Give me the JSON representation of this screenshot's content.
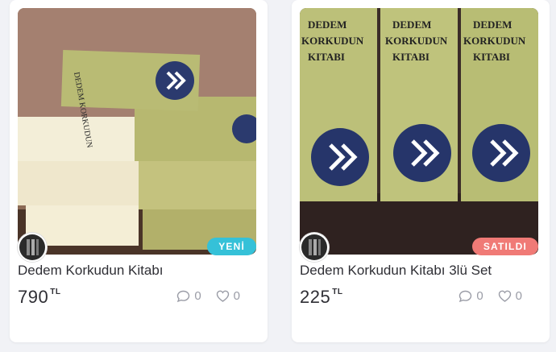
{
  "listings": [
    {
      "title": "Dedem Korkudun Kitabı",
      "price": "790",
      "currency": "TL",
      "badge": "YENİ",
      "comments": "0",
      "likes": "0"
    },
    {
      "title": "Dedem Korkudun Kitabı 3lü Set",
      "price": "225",
      "currency": "TL",
      "badge": "SATILDI",
      "comments": "0",
      "likes": "0"
    }
  ],
  "colors": {
    "badge_new": "#35c1d8",
    "badge_sold": "#f07a76",
    "text": "#2f2f35",
    "muted": "#9a9ca6",
    "page_bg": "#f1f2f6"
  },
  "icons": [
    "comment-icon",
    "heart-icon",
    "avatar"
  ]
}
